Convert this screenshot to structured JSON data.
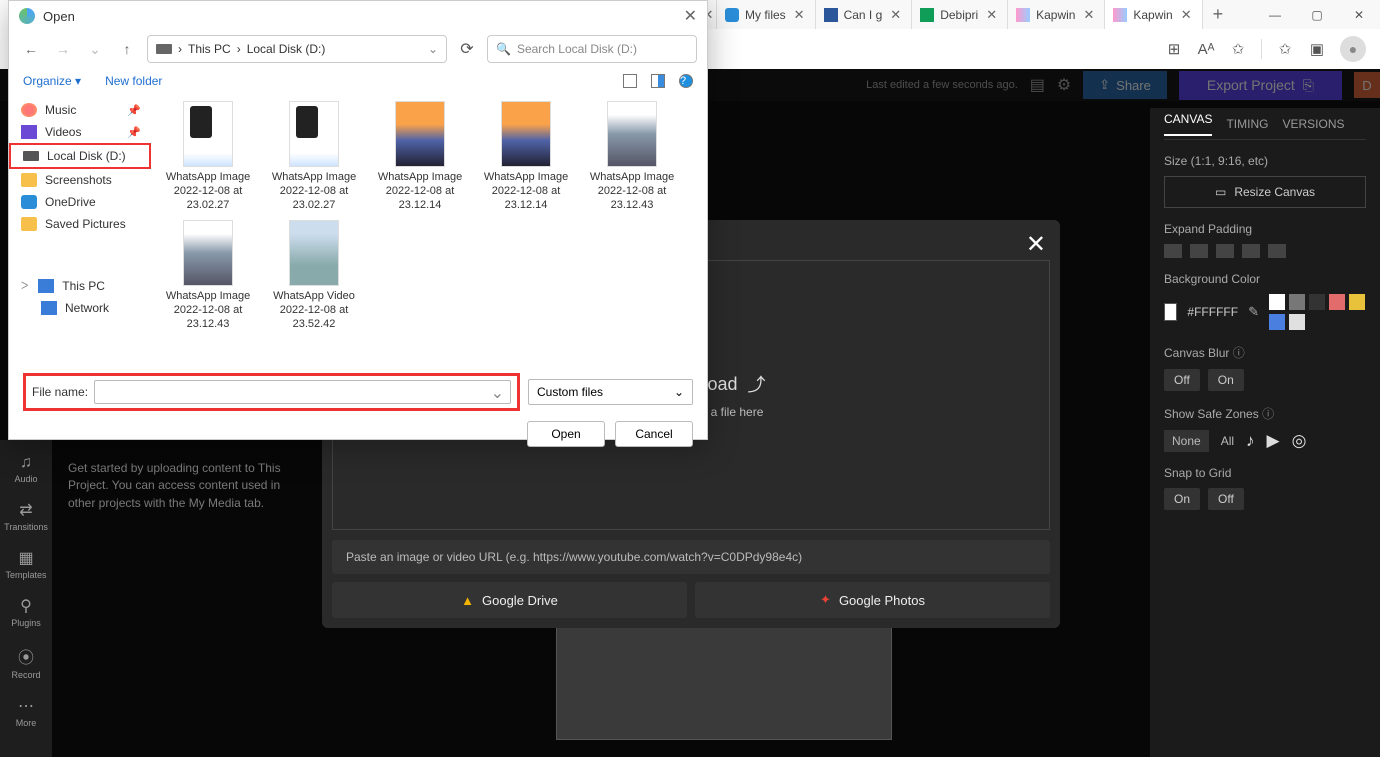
{
  "browser": {
    "tabs": [
      {
        "label": "Open",
        "type": "dialog"
      },
      {
        "label": "My files"
      },
      {
        "label": "Can I g"
      },
      {
        "label": "Debipri"
      },
      {
        "label": "Kapwin"
      },
      {
        "label": "Kapwin",
        "active": true
      }
    ],
    "add": "+",
    "win": {
      "min": "—",
      "max": "▢",
      "close": "✕"
    }
  },
  "kapwing": {
    "last_edited": "Last edited a few seconds ago.",
    "share": "Share",
    "export": "Export Project",
    "user_initial": "D",
    "sidebar": [
      {
        "icon": "♫",
        "label": "Audio"
      },
      {
        "icon": "⇄",
        "label": "Transitions"
      },
      {
        "icon": "▦",
        "label": "Templates"
      },
      {
        "icon": "⚲",
        "label": "Plugins"
      },
      {
        "icon": "⦿",
        "label": "Record"
      },
      {
        "icon": "⋯",
        "label": "More"
      }
    ],
    "getstarted": "Get started by uploading content to This Project. You can access content used in other projects with the My Media tab.",
    "upload": {
      "title": "Click to Upload",
      "sub": "or drag and drop a file here",
      "url_placeholder": "Paste an image or video URL (e.g. https://www.youtube.com/watch?v=C0DPdy98e4c)",
      "gdrive": "Google Drive",
      "gphotos": "Google Photos"
    },
    "right": {
      "tabs": [
        "CANVAS",
        "TIMING",
        "VERSIONS"
      ],
      "size_label": "Size (1:1, 9:16, etc)",
      "resize": "Resize Canvas",
      "expand_label": "Expand Padding",
      "bg_label": "Background Color",
      "bg_value": "#FFFFFF",
      "blur_label": "Canvas Blur",
      "blur_off": "Off",
      "blur_on": "On",
      "safe_label": "Show Safe Zones",
      "safe_none": "None",
      "safe_all": "All",
      "snap_label": "Snap to Grid",
      "snap_on": "On",
      "snap_off": "Off",
      "palette": [
        "#ffffff",
        "#777777",
        "#333333",
        "#e26b6b",
        "#e8c23a",
        "#4a7fe0",
        "#e0e0e0"
      ]
    }
  },
  "dialog": {
    "title": "Open",
    "breadcrumb": [
      "This PC",
      "Local Disk (D:)"
    ],
    "search_placeholder": "Search Local Disk (D:)",
    "organize": "Organize ▾",
    "new_folder": "New folder",
    "side_items": [
      {
        "label": "Music",
        "icon": "music",
        "pin": true
      },
      {
        "label": "Videos",
        "icon": "video",
        "pin": true
      },
      {
        "label": "Local Disk (D:)",
        "icon": "disk",
        "highlight": true
      },
      {
        "label": "Screenshots",
        "icon": "folder"
      },
      {
        "label": "OneDrive",
        "icon": "onedrive"
      },
      {
        "label": "Saved Pictures",
        "icon": "folder"
      }
    ],
    "side_bottom": [
      {
        "label": "This PC",
        "icon": "pc",
        "expander": true
      },
      {
        "label": "Network",
        "icon": "net",
        "expander": false
      }
    ],
    "files": [
      {
        "name": "WhatsApp Image 2022-12-08 at 23.02.27",
        "thumb": "chat"
      },
      {
        "name": "WhatsApp Image 2022-12-08 at 23.02.27",
        "thumb": "chat"
      },
      {
        "name": "WhatsApp Image 2022-12-08 at 23.12.14",
        "thumb": "sunset"
      },
      {
        "name": "WhatsApp Image 2022-12-08 at 23.12.14",
        "thumb": "sunset"
      },
      {
        "name": "WhatsApp Image 2022-12-08 at 23.12.43",
        "thumb": "gallery"
      },
      {
        "name": "WhatsApp Image 2022-12-08 at 23.12.43",
        "thumb": "gallery"
      },
      {
        "name": "WhatsApp Video 2022-12-08 at 23.52.42",
        "thumb": "video"
      }
    ],
    "file_name_label": "File name:",
    "file_type": "Custom files",
    "open": "Open",
    "cancel": "Cancel"
  }
}
